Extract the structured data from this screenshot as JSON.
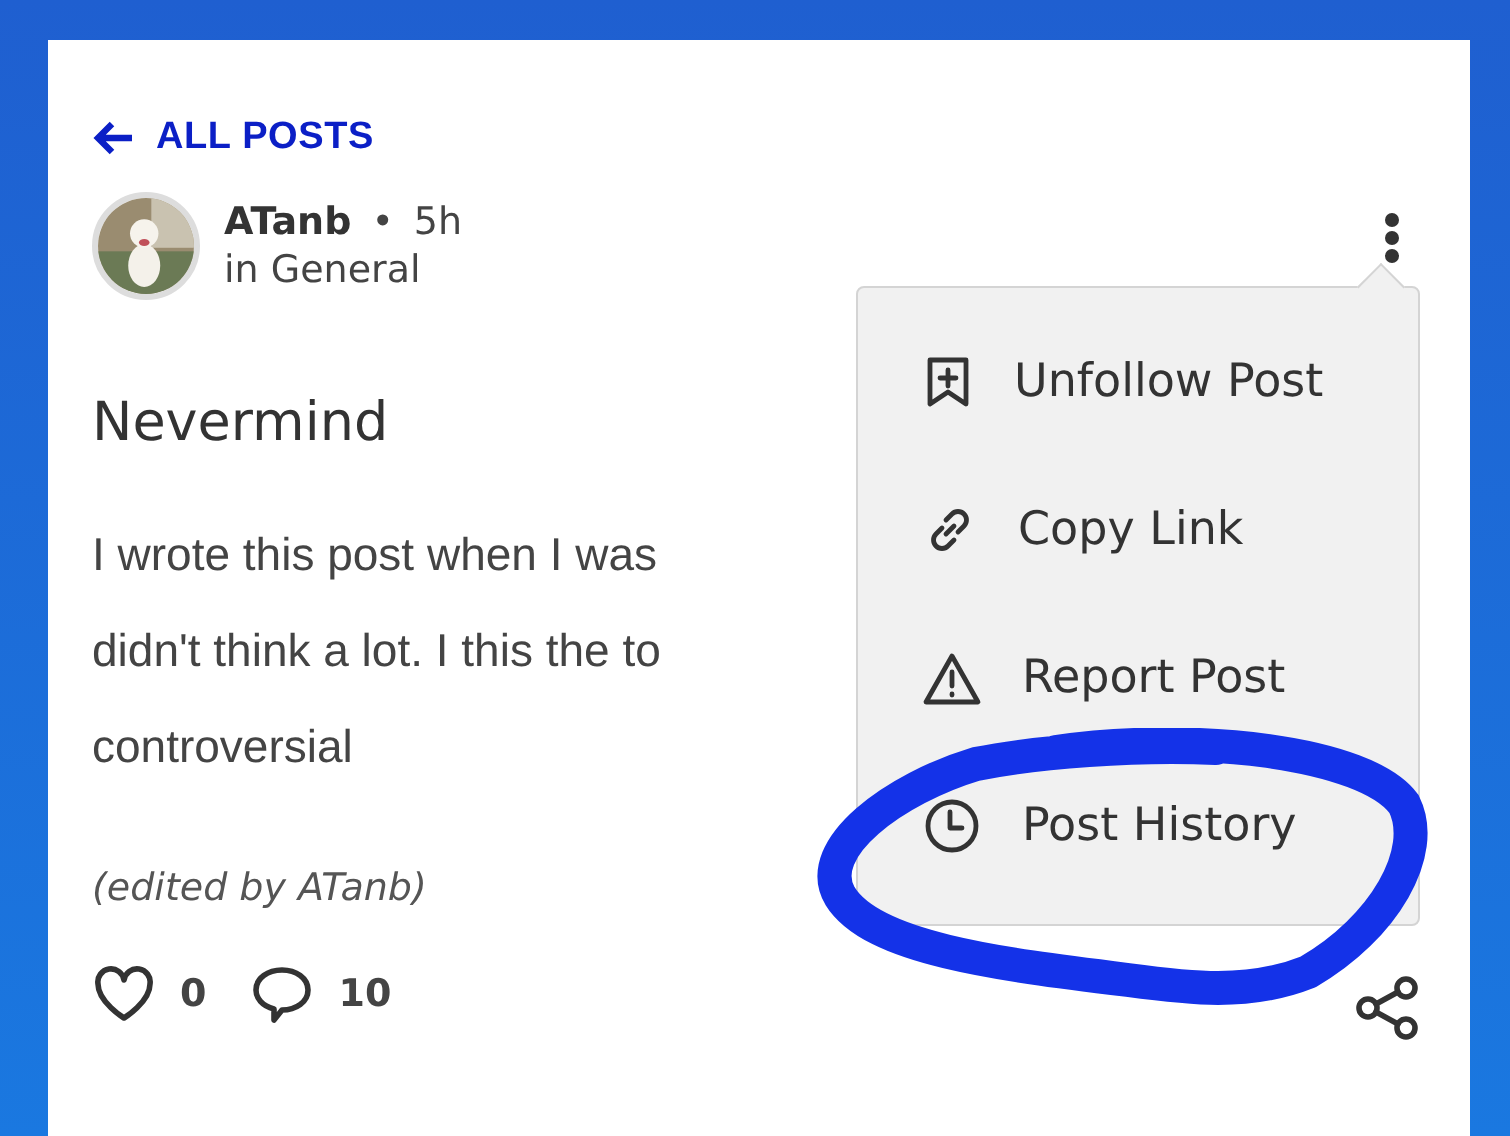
{
  "back_link": {
    "label": "ALL POSTS"
  },
  "post": {
    "author": "ATanb",
    "separator": "•",
    "age": "5h",
    "category": "in General",
    "title": "Nevermind",
    "body_lines": [
      "I wrote this post when I was",
      "didn't think a lot. I this the to",
      "controversial"
    ],
    "edited_note": "(edited by ATanb)",
    "likes": "0",
    "comments": "10"
  },
  "menu": {
    "open": true,
    "items": [
      {
        "kind": "bookmark",
        "label": "Unfollow Post"
      },
      {
        "kind": "link",
        "label": "Copy Link"
      },
      {
        "kind": "warning",
        "label": "Report Post"
      },
      {
        "kind": "history",
        "label": "Post History"
      }
    ]
  },
  "annotation": {
    "kind": "circle"
  }
}
